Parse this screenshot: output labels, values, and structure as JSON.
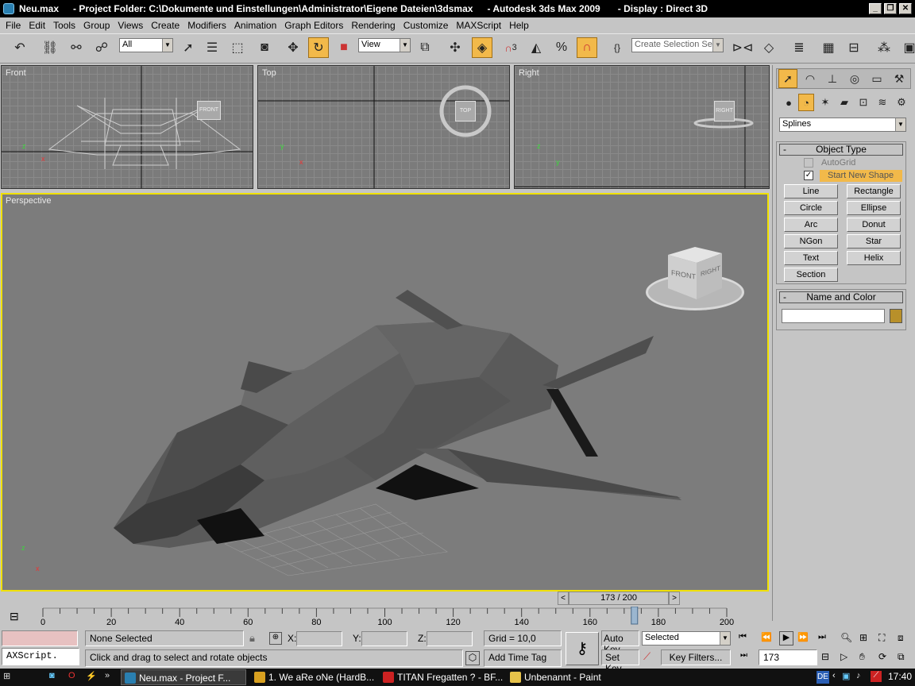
{
  "window": {
    "title": "Neu.max",
    "project": "- Project Folder: C:\\Dokumente und Einstellungen\\Administrator\\Eigene Dateien\\3dsmax",
    "app": "- Autodesk 3ds Max  2009",
    "display": "- Display : Direct 3D"
  },
  "menu": [
    "File",
    "Edit",
    "Tools",
    "Group",
    "Views",
    "Create",
    "Modifiers",
    "Animation",
    "Graph Editors",
    "Rendering",
    "Customize",
    "MAXScript",
    "Help"
  ],
  "toolbar": {
    "filter_value": "All",
    "refcoord_value": "View",
    "snap_label": "3",
    "selection_set_placeholder": "Create Selection Set"
  },
  "viewports": {
    "front": {
      "label": "Front",
      "cube": "FRONT"
    },
    "top": {
      "label": "Top",
      "cube": "TOP"
    },
    "right": {
      "label": "Right",
      "cube": "RIGHT"
    },
    "perspective": {
      "label": "Perspective",
      "cube_front": "FRONT",
      "cube_right": "RIGHT"
    }
  },
  "command_panel": {
    "category": "Splines",
    "object_type": {
      "title": "Object Type",
      "autogrid": "AutoGrid",
      "start_new_shape": "Start New Shape",
      "buttons": [
        "Line",
        "Rectangle",
        "Circle",
        "Ellipse",
        "Arc",
        "Donut",
        "NGon",
        "Star",
        "Text",
        "Helix",
        "Section"
      ]
    },
    "name_color": {
      "title": "Name and Color",
      "name_value": "",
      "color": "#b8902a"
    }
  },
  "timeline": {
    "current": 173,
    "end": 200,
    "display": "173 / 200",
    "ticks": [
      "0",
      "20",
      "40",
      "60",
      "80",
      "100",
      "120",
      "140",
      "160",
      "180",
      "200"
    ]
  },
  "status": {
    "maxscript": "AXScript.",
    "selection": "None Selected",
    "x_label": "X:",
    "y_label": "Y:",
    "z_label": "Z:",
    "grid": "Grid = 10,0",
    "prompt": "Click and drag to select and rotate objects",
    "add_time_tag": "Add Time Tag",
    "auto_key": "Auto Key",
    "set_key": "Set Key",
    "selected_option": "Selected",
    "key_filters": "Key Filters...",
    "frame": "173"
  },
  "taskbar": {
    "tasks": [
      "Neu.max      - Project F...",
      "1. We aRe oNe (HardB...",
      "TITAN Fregatten ? - BF...",
      "Unbenannt - Paint"
    ],
    "language": "DE",
    "clock": "17:40"
  }
}
